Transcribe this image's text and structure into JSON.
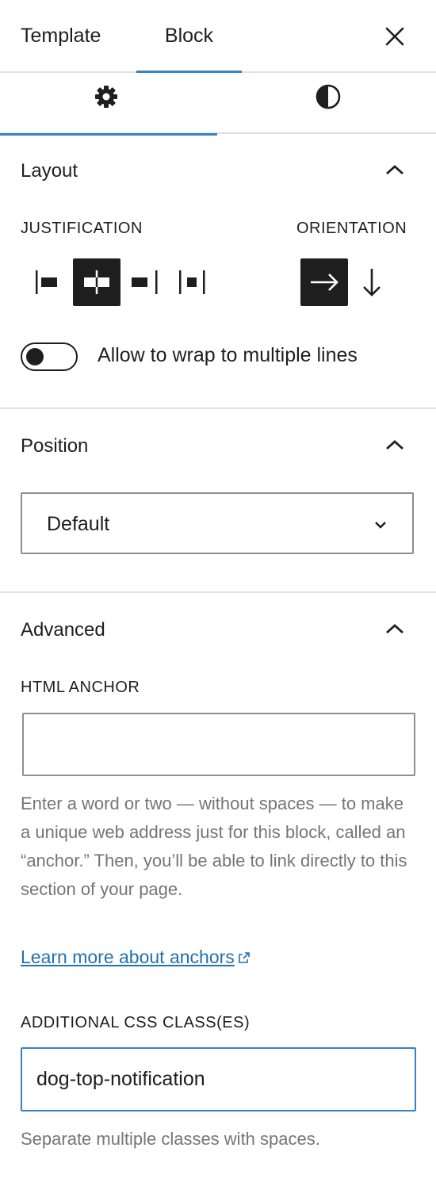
{
  "header": {
    "tabs": [
      {
        "label": "Template",
        "active": false
      },
      {
        "label": "Block",
        "active": true
      }
    ],
    "close_icon": "close-icon"
  },
  "subtabs": [
    {
      "icon": "gear-icon",
      "active": true
    },
    {
      "icon": "contrast-icon",
      "active": false
    }
  ],
  "layout": {
    "title": "Layout",
    "justification_label": "Justification",
    "justification_options": [
      "justify-left",
      "justify-center",
      "justify-right",
      "justify-space-between"
    ],
    "justification_selected": "justify-center",
    "orientation_label": "Orientation",
    "orientation_options": [
      "horizontal-arrow",
      "vertical-arrow"
    ],
    "orientation_selected": "horizontal-arrow",
    "wrap_label": "Allow to wrap to multiple lines",
    "wrap_enabled": false
  },
  "position": {
    "title": "Position",
    "select_value": "Default"
  },
  "advanced": {
    "title": "Advanced",
    "anchor_label": "HTML anchor",
    "anchor_value": "",
    "anchor_help": "Enter a word or two — without spaces — to make a unique web address just for this block, called an “anchor.” Then, you’ll be able to link directly to this section of your page.",
    "anchor_link": "Learn more about anchors",
    "css_label": "Additional CSS class(es)",
    "css_value": "dog-top-notification",
    "css_help": "Separate multiple classes with spaces."
  },
  "colors": {
    "accent": "#3582c4",
    "link": "#2271b1",
    "text": "#1e1e1e",
    "muted": "#757575",
    "border": "#8c8f94"
  }
}
